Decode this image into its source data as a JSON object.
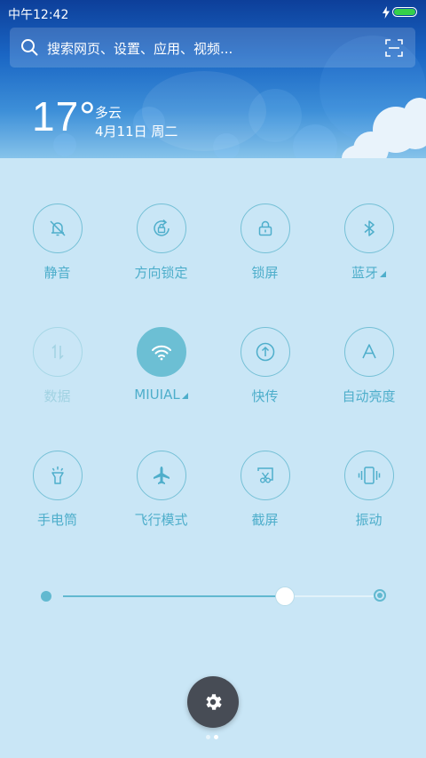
{
  "status_bar": {
    "time": "中午12:42",
    "charging": true,
    "battery_level": 1.0
  },
  "search": {
    "placeholder": "搜索网页、设置、应用、视频..."
  },
  "weather": {
    "temperature": "17°",
    "condition": "多云",
    "date": "4月11日 周二"
  },
  "toggles": [
    {
      "label": "静音",
      "icon": "bell-muted-icon",
      "state": "off"
    },
    {
      "label": "方向锁定",
      "icon": "rotation-lock-icon",
      "state": "off"
    },
    {
      "label": "锁屏",
      "icon": "lock-icon",
      "state": "off"
    },
    {
      "label": "蓝牙",
      "icon": "bluetooth-icon",
      "state": "off",
      "has_menu": true
    },
    {
      "label": "数据",
      "icon": "data-arrows-icon",
      "state": "disabled"
    },
    {
      "label": "MIUIAL",
      "icon": "wifi-icon",
      "state": "on",
      "has_menu": true
    },
    {
      "label": "快传",
      "icon": "quick-transfer-icon",
      "state": "off"
    },
    {
      "label": "自动亮度",
      "icon": "auto-brightness-icon",
      "state": "off"
    },
    {
      "label": "手电筒",
      "icon": "flashlight-icon",
      "state": "off"
    },
    {
      "label": "飞行模式",
      "icon": "airplane-icon",
      "state": "off"
    },
    {
      "label": "截屏",
      "icon": "screenshot-icon",
      "state": "off"
    },
    {
      "label": "振动",
      "icon": "vibrate-icon",
      "state": "off"
    }
  ],
  "brightness": {
    "level": 0.71
  },
  "settings_button": {
    "icon": "gear-icon"
  },
  "pager": {
    "pages": 2,
    "current": 2
  },
  "colors": {
    "accent": "#4eaecb",
    "panel_bg": "#c9e6f6",
    "active_toggle": "#6cbfd4",
    "fab": "#474c55"
  }
}
